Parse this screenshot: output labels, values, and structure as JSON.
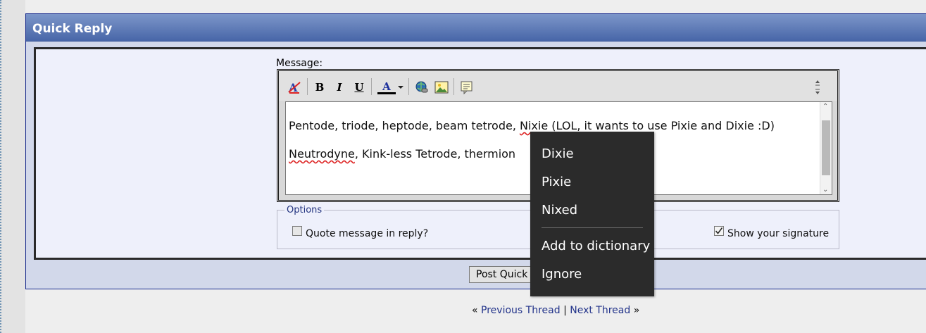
{
  "panel": {
    "title": "Quick Reply"
  },
  "editor": {
    "label": "Message:",
    "toolbar": {
      "bold": "B",
      "italic": "I",
      "underline": "U",
      "font_color_letter": "A"
    },
    "text": {
      "line1_a": "Pentode, triode, heptode, beam tetrode, ",
      "line1_misspelled": "Nixie",
      "line1_b": " (LOL, it wants to use Pixie and Dixie :D)",
      "line2_misspelled": "Neutrodyne",
      "line2_b": ", Kink-less Tetrode, thermion"
    }
  },
  "options": {
    "legend": "Options",
    "quote_label": "Quote message in reply?",
    "quote_checked": false,
    "signature_label": "Show your signature",
    "signature_checked": true
  },
  "post_button": {
    "label": "Post Quick"
  },
  "thread_nav": {
    "prev": "Previous Thread",
    "next": "Next Thread",
    "laquo": "«",
    "raquo": "»",
    "divider": "|"
  },
  "context_menu": {
    "suggestions": [
      "Dixie",
      "Pixie",
      "Nixed"
    ],
    "add": "Add to dictionary",
    "ignore": "Ignore"
  },
  "colors": {
    "header_top": "#7c96c9",
    "header_bottom": "#4866a8",
    "link": "#22338a",
    "menu_bg": "#2b2b2b"
  }
}
